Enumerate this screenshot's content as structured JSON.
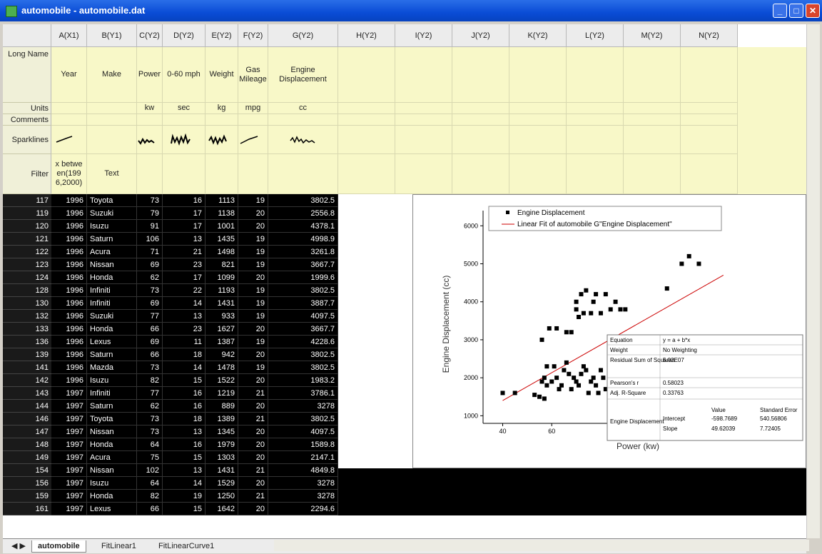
{
  "window": {
    "title": "automobile - automobile.dat",
    "min": "_",
    "max": "□",
    "close": "✕"
  },
  "columns": [
    {
      "id": "col-a",
      "header": "A(X1)",
      "long": "Year",
      "units": "",
      "comments": "",
      "filter": "x betwe en(199 6,2000)",
      "w": 50
    },
    {
      "id": "col-b",
      "header": "B(Y1)",
      "long": "Make",
      "units": "",
      "comments": "",
      "filter": "Text",
      "w": 70
    },
    {
      "id": "col-c",
      "header": "C(Y2)",
      "long": "Power",
      "units": "kw",
      "comments": "",
      "filter": "",
      "w": 36
    },
    {
      "id": "col-d",
      "header": "D(Y2)",
      "long": "0-60 mph",
      "units": "sec",
      "comments": "",
      "filter": "",
      "w": 60
    },
    {
      "id": "col-e",
      "header": "E(Y2)",
      "long": "Weight",
      "units": "kg",
      "comments": "",
      "filter": "",
      "w": 46
    },
    {
      "id": "col-f",
      "header": "F(Y2)",
      "long": "Gas Mileage",
      "units": "mpg",
      "comments": "",
      "filter": "",
      "w": 42
    },
    {
      "id": "col-g",
      "header": "G(Y2)",
      "long": "Engine Displacement",
      "units": "cc",
      "comments": "",
      "filter": "",
      "w": 98
    },
    {
      "id": "col-h",
      "header": "H(Y2)",
      "long": "",
      "units": "",
      "comments": "",
      "filter": "",
      "w": 80
    },
    {
      "id": "col-i",
      "header": "I(Y2)",
      "long": "",
      "units": "",
      "comments": "",
      "filter": "",
      "w": 80
    },
    {
      "id": "col-j",
      "header": "J(Y2)",
      "long": "",
      "units": "",
      "comments": "",
      "filter": "",
      "w": 80
    },
    {
      "id": "col-k",
      "header": "K(Y2)",
      "long": "",
      "units": "",
      "comments": "",
      "filter": "",
      "w": 80
    },
    {
      "id": "col-l",
      "header": "L(Y2)",
      "long": "",
      "units": "",
      "comments": "",
      "filter": "",
      "w": 80
    },
    {
      "id": "col-m",
      "header": "M(Y2)",
      "long": "",
      "units": "",
      "comments": "",
      "filter": "",
      "w": 80
    },
    {
      "id": "col-n",
      "header": "N(Y2)",
      "long": "",
      "units": "",
      "comments": "",
      "filter": "",
      "w": 80
    }
  ],
  "meta_labels": {
    "long": "Long Name",
    "units": "Units",
    "comments": "Comments",
    "sparklines": "Sparklines",
    "filter": "Filter"
  },
  "rows": [
    [
      "117",
      "1996",
      "Toyota",
      "73",
      "16",
      "1113",
      "19",
      "3802.5"
    ],
    [
      "119",
      "1996",
      "Suzuki",
      "79",
      "17",
      "1138",
      "20",
      "2556.8"
    ],
    [
      "120",
      "1996",
      "Isuzu",
      "91",
      "17",
      "1001",
      "20",
      "4378.1"
    ],
    [
      "121",
      "1996",
      "Saturn",
      "106",
      "13",
      "1435",
      "19",
      "4998.9"
    ],
    [
      "122",
      "1996",
      "Acura",
      "71",
      "21",
      "1498",
      "19",
      "3261.8"
    ],
    [
      "123",
      "1996",
      "Nissan",
      "69",
      "23",
      "821",
      "19",
      "3667.7"
    ],
    [
      "124",
      "1996",
      "Honda",
      "62",
      "17",
      "1099",
      "20",
      "1999.6"
    ],
    [
      "128",
      "1996",
      "Infiniti",
      "73",
      "22",
      "1193",
      "19",
      "3802.5"
    ],
    [
      "130",
      "1996",
      "Infiniti",
      "69",
      "14",
      "1431",
      "19",
      "3887.7"
    ],
    [
      "132",
      "1996",
      "Suzuki",
      "77",
      "13",
      "933",
      "19",
      "4097.5"
    ],
    [
      "133",
      "1996",
      "Honda",
      "66",
      "23",
      "1627",
      "20",
      "3667.7"
    ],
    [
      "136",
      "1996",
      "Lexus",
      "69",
      "11",
      "1387",
      "19",
      "4228.6"
    ],
    [
      "139",
      "1996",
      "Saturn",
      "66",
      "18",
      "942",
      "20",
      "3802.5"
    ],
    [
      "141",
      "1996",
      "Mazda",
      "73",
      "14",
      "1478",
      "19",
      "3802.5"
    ],
    [
      "142",
      "1996",
      "Isuzu",
      "82",
      "15",
      "1522",
      "20",
      "1983.2"
    ],
    [
      "143",
      "1997",
      "Infiniti",
      "77",
      "16",
      "1219",
      "21",
      "3786.1"
    ],
    [
      "144",
      "1997",
      "Saturn",
      "62",
      "16",
      "889",
      "20",
      "3278"
    ],
    [
      "146",
      "1997",
      "Toyota",
      "73",
      "18",
      "1389",
      "21",
      "3802.5"
    ],
    [
      "147",
      "1997",
      "Nissan",
      "73",
      "13",
      "1345",
      "20",
      "4097.5"
    ],
    [
      "148",
      "1997",
      "Honda",
      "64",
      "16",
      "1979",
      "20",
      "1589.8"
    ],
    [
      "149",
      "1997",
      "Acura",
      "75",
      "15",
      "1303",
      "20",
      "2147.1"
    ],
    [
      "154",
      "1997",
      "Nissan",
      "102",
      "13",
      "1431",
      "21",
      "4849.8"
    ],
    [
      "156",
      "1997",
      "Isuzu",
      "64",
      "14",
      "1529",
      "20",
      "3278"
    ],
    [
      "159",
      "1997",
      "Honda",
      "82",
      "19",
      "1250",
      "21",
      "3278"
    ],
    [
      "161",
      "1997",
      "Lexus",
      "66",
      "15",
      "1642",
      "20",
      "2294.6"
    ]
  ],
  "chart_data": {
    "type": "scatter",
    "xlabel": "Power (kw)",
    "ylabel": "Engine Displacement (cc)",
    "xlim": [
      32,
      135
    ],
    "ylim": [
      800,
      6400
    ],
    "xticks": [
      40,
      60
    ],
    "yticks": [
      1000,
      2000,
      3000,
      4000,
      5000,
      6000
    ],
    "legend": [
      "Engine Displacement",
      "Linear Fit of automobile G\"Engine Displacement\""
    ],
    "legend_position": "top",
    "fit_line": {
      "x": [
        40,
        130
      ],
      "y": [
        1400,
        4700
      ],
      "color": "#cc0000"
    },
    "points": [
      [
        40,
        1600
      ],
      [
        45,
        1600
      ],
      [
        53,
        1550
      ],
      [
        55,
        1500
      ],
      [
        56,
        1900
      ],
      [
        57,
        1450
      ],
      [
        58,
        1800
      ],
      [
        57,
        2000
      ],
      [
        58,
        2300
      ],
      [
        60,
        1900
      ],
      [
        61,
        2300
      ],
      [
        62,
        2000
      ],
      [
        63,
        1700
      ],
      [
        64,
        1800
      ],
      [
        65,
        2200
      ],
      [
        66,
        2400
      ],
      [
        67,
        2100
      ],
      [
        68,
        1700
      ],
      [
        69,
        2000
      ],
      [
        70,
        1900
      ],
      [
        71,
        1800
      ],
      [
        72,
        2100
      ],
      [
        73,
        2300
      ],
      [
        74,
        2200
      ],
      [
        75,
        1600
      ],
      [
        76,
        1900
      ],
      [
        77,
        2000
      ],
      [
        78,
        1800
      ],
      [
        79,
        1600
      ],
      [
        80,
        2200
      ],
      [
        81,
        2000
      ],
      [
        82,
        1700
      ],
      [
        56,
        3000
      ],
      [
        59,
        3300
      ],
      [
        62,
        3300
      ],
      [
        66,
        3200
      ],
      [
        68,
        3200
      ],
      [
        70,
        3800
      ],
      [
        71,
        3600
      ],
      [
        72,
        4200
      ],
      [
        74,
        4300
      ],
      [
        76,
        3700
      ],
      [
        77,
        4000
      ],
      [
        78,
        4200
      ],
      [
        80,
        3700
      ],
      [
        82,
        4200
      ],
      [
        84,
        3800
      ],
      [
        86,
        4000
      ],
      [
        88,
        3800
      ],
      [
        90,
        3800
      ],
      [
        70,
        4000
      ],
      [
        73,
        3700
      ],
      [
        107,
        4350
      ],
      [
        113,
        5000
      ],
      [
        116,
        5200
      ],
      [
        120,
        5000
      ]
    ],
    "stats_table": {
      "equation": [
        "Equation",
        "y = a + b*x"
      ],
      "weight": [
        "Weight",
        "No Weighting"
      ],
      "rss": [
        "Residual Sum of Squares",
        "5.02E07"
      ],
      "pearson": [
        "Pearson's r",
        "0.58023"
      ],
      "adjr2": [
        "Adj. R-Square",
        "0.33763"
      ],
      "col_value": "Value",
      "col_err": "Standard Error",
      "row_label": "Engine Displacement",
      "intercept": [
        "Intercept",
        "-598.7689",
        "540.56806"
      ],
      "slope": [
        "Slope",
        "49.62039",
        "7.72405"
      ]
    }
  },
  "tabs": [
    {
      "label": "automobile",
      "active": true
    },
    {
      "label": "FitLinear1",
      "active": false
    },
    {
      "label": "FitLinearCurve1",
      "active": false
    }
  ]
}
